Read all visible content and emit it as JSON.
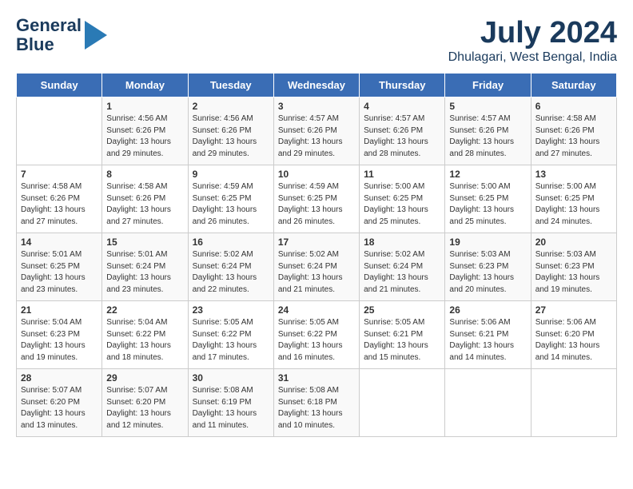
{
  "logo": {
    "line1": "General",
    "line2": "Blue"
  },
  "title": "July 2024",
  "location": "Dhulagari, West Bengal, India",
  "days_of_week": [
    "Sunday",
    "Monday",
    "Tuesday",
    "Wednesday",
    "Thursday",
    "Friday",
    "Saturday"
  ],
  "weeks": [
    [
      {
        "day": "",
        "info": ""
      },
      {
        "day": "1",
        "info": "Sunrise: 4:56 AM\nSunset: 6:26 PM\nDaylight: 13 hours\nand 29 minutes."
      },
      {
        "day": "2",
        "info": "Sunrise: 4:56 AM\nSunset: 6:26 PM\nDaylight: 13 hours\nand 29 minutes."
      },
      {
        "day": "3",
        "info": "Sunrise: 4:57 AM\nSunset: 6:26 PM\nDaylight: 13 hours\nand 29 minutes."
      },
      {
        "day": "4",
        "info": "Sunrise: 4:57 AM\nSunset: 6:26 PM\nDaylight: 13 hours\nand 28 minutes."
      },
      {
        "day": "5",
        "info": "Sunrise: 4:57 AM\nSunset: 6:26 PM\nDaylight: 13 hours\nand 28 minutes."
      },
      {
        "day": "6",
        "info": "Sunrise: 4:58 AM\nSunset: 6:26 PM\nDaylight: 13 hours\nand 27 minutes."
      }
    ],
    [
      {
        "day": "7",
        "info": "Sunrise: 4:58 AM\nSunset: 6:26 PM\nDaylight: 13 hours\nand 27 minutes."
      },
      {
        "day": "8",
        "info": "Sunrise: 4:58 AM\nSunset: 6:26 PM\nDaylight: 13 hours\nand 27 minutes."
      },
      {
        "day": "9",
        "info": "Sunrise: 4:59 AM\nSunset: 6:25 PM\nDaylight: 13 hours\nand 26 minutes."
      },
      {
        "day": "10",
        "info": "Sunrise: 4:59 AM\nSunset: 6:25 PM\nDaylight: 13 hours\nand 26 minutes."
      },
      {
        "day": "11",
        "info": "Sunrise: 5:00 AM\nSunset: 6:25 PM\nDaylight: 13 hours\nand 25 minutes."
      },
      {
        "day": "12",
        "info": "Sunrise: 5:00 AM\nSunset: 6:25 PM\nDaylight: 13 hours\nand 25 minutes."
      },
      {
        "day": "13",
        "info": "Sunrise: 5:00 AM\nSunset: 6:25 PM\nDaylight: 13 hours\nand 24 minutes."
      }
    ],
    [
      {
        "day": "14",
        "info": "Sunrise: 5:01 AM\nSunset: 6:25 PM\nDaylight: 13 hours\nand 23 minutes."
      },
      {
        "day": "15",
        "info": "Sunrise: 5:01 AM\nSunset: 6:24 PM\nDaylight: 13 hours\nand 23 minutes."
      },
      {
        "day": "16",
        "info": "Sunrise: 5:02 AM\nSunset: 6:24 PM\nDaylight: 13 hours\nand 22 minutes."
      },
      {
        "day": "17",
        "info": "Sunrise: 5:02 AM\nSunset: 6:24 PM\nDaylight: 13 hours\nand 21 minutes."
      },
      {
        "day": "18",
        "info": "Sunrise: 5:02 AM\nSunset: 6:24 PM\nDaylight: 13 hours\nand 21 minutes."
      },
      {
        "day": "19",
        "info": "Sunrise: 5:03 AM\nSunset: 6:23 PM\nDaylight: 13 hours\nand 20 minutes."
      },
      {
        "day": "20",
        "info": "Sunrise: 5:03 AM\nSunset: 6:23 PM\nDaylight: 13 hours\nand 19 minutes."
      }
    ],
    [
      {
        "day": "21",
        "info": "Sunrise: 5:04 AM\nSunset: 6:23 PM\nDaylight: 13 hours\nand 19 minutes."
      },
      {
        "day": "22",
        "info": "Sunrise: 5:04 AM\nSunset: 6:22 PM\nDaylight: 13 hours\nand 18 minutes."
      },
      {
        "day": "23",
        "info": "Sunrise: 5:05 AM\nSunset: 6:22 PM\nDaylight: 13 hours\nand 17 minutes."
      },
      {
        "day": "24",
        "info": "Sunrise: 5:05 AM\nSunset: 6:22 PM\nDaylight: 13 hours\nand 16 minutes."
      },
      {
        "day": "25",
        "info": "Sunrise: 5:05 AM\nSunset: 6:21 PM\nDaylight: 13 hours\nand 15 minutes."
      },
      {
        "day": "26",
        "info": "Sunrise: 5:06 AM\nSunset: 6:21 PM\nDaylight: 13 hours\nand 14 minutes."
      },
      {
        "day": "27",
        "info": "Sunrise: 5:06 AM\nSunset: 6:20 PM\nDaylight: 13 hours\nand 14 minutes."
      }
    ],
    [
      {
        "day": "28",
        "info": "Sunrise: 5:07 AM\nSunset: 6:20 PM\nDaylight: 13 hours\nand 13 minutes."
      },
      {
        "day": "29",
        "info": "Sunrise: 5:07 AM\nSunset: 6:20 PM\nDaylight: 13 hours\nand 12 minutes."
      },
      {
        "day": "30",
        "info": "Sunrise: 5:08 AM\nSunset: 6:19 PM\nDaylight: 13 hours\nand 11 minutes."
      },
      {
        "day": "31",
        "info": "Sunrise: 5:08 AM\nSunset: 6:18 PM\nDaylight: 13 hours\nand 10 minutes."
      },
      {
        "day": "",
        "info": ""
      },
      {
        "day": "",
        "info": ""
      },
      {
        "day": "",
        "info": ""
      }
    ]
  ]
}
